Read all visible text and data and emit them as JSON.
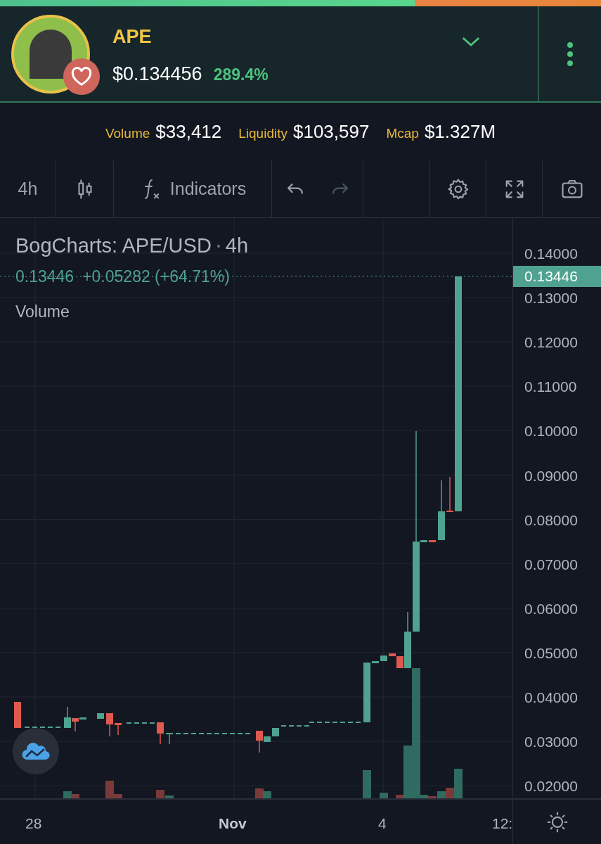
{
  "top_bar": {
    "level": 0.69
  },
  "token": {
    "name": "APE",
    "price": "$0.134456",
    "change": "289.4%"
  },
  "stats": [
    {
      "label": "Volume",
      "value": "$33,412"
    },
    {
      "label": "Liquidity",
      "value": "$103,597"
    },
    {
      "label": "Mcap",
      "value": "$1.327M"
    }
  ],
  "toolbar": [
    {
      "kind": "interval",
      "label": "4h"
    },
    {
      "kind": "candles"
    },
    {
      "kind": "indicators",
      "label": "Indicators"
    },
    {
      "kind": "undo",
      "disabled": false
    },
    {
      "kind": "redo",
      "disabled": true
    },
    {
      "kind": "spacer"
    },
    {
      "kind": "settings"
    },
    {
      "kind": "fullscreen"
    },
    {
      "kind": "camera"
    }
  ],
  "chart": {
    "title": "BogCharts: APE/USD",
    "interval": "4h",
    "last": "0.13446",
    "change": "+0.05282 (+64.71%)",
    "volume_label": "Volume",
    "price_ticks": [
      "0.14000",
      "0.13000",
      "0.12000",
      "0.11000",
      "0.10000",
      "0.09000",
      "0.08000",
      "0.07000",
      "0.06000",
      "0.05000",
      "0.04000",
      "0.03000",
      "0.02000"
    ],
    "current_price": "0.13446",
    "time_ticks": [
      {
        "label": "28",
        "bold": false
      },
      {
        "label": "Nov",
        "bold": true
      },
      {
        "label": "4",
        "bold": false
      },
      {
        "label": "12:",
        "bold": false
      }
    ]
  }
}
